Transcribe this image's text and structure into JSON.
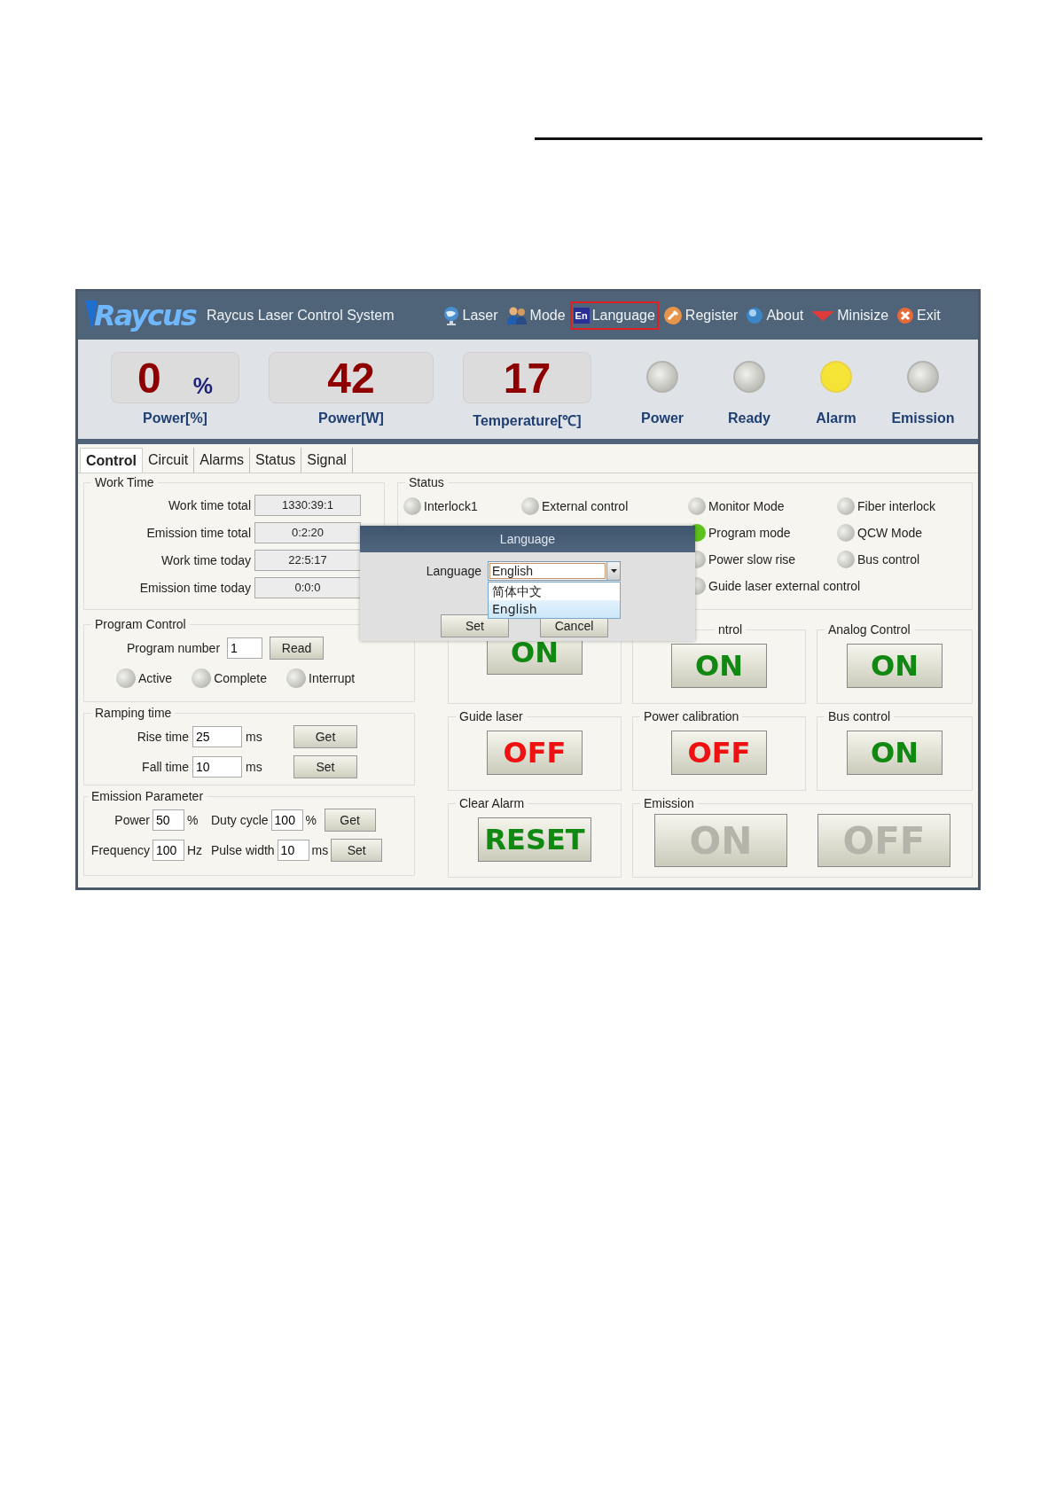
{
  "app": {
    "logo": "Raycus",
    "title": "Raycus Laser Control System"
  },
  "menu": [
    {
      "label": "Laser",
      "selected": false
    },
    {
      "label": "Mode",
      "selected": false
    },
    {
      "label": "Language",
      "badge": "En",
      "selected": true
    },
    {
      "label": "Register",
      "selected": false
    },
    {
      "label": "About",
      "selected": false
    },
    {
      "label": "Minisize",
      "selected": false
    },
    {
      "label": "Exit",
      "selected": false
    }
  ],
  "readouts": [
    {
      "value": "0",
      "unit": "%",
      "label": "Power[%]"
    },
    {
      "value": "42",
      "label": "Power[W]"
    },
    {
      "value": "17",
      "label": "Temperature[℃]"
    }
  ],
  "lamps": [
    {
      "label": "Power",
      "on": false
    },
    {
      "label": "Ready",
      "on": false
    },
    {
      "label": "Alarm",
      "on": true,
      "color": "#f5e336"
    },
    {
      "label": "Emission",
      "on": false
    }
  ],
  "tabs": [
    {
      "label": "Control",
      "selected": true
    },
    {
      "label": "Circuit",
      "selected": false
    },
    {
      "label": "Alarms",
      "selected": false
    },
    {
      "label": "Status",
      "selected": false
    },
    {
      "label": "Signal",
      "selected": false
    }
  ],
  "work_time": {
    "title": "Work Time",
    "rows": [
      {
        "label": "Work time total",
        "value": "1330:39:1"
      },
      {
        "label": "Emission time total",
        "value": "0:2:20"
      },
      {
        "label": "Work time today",
        "value": "22:5:17"
      },
      {
        "label": "Emission time today",
        "value": "0:0:0"
      }
    ]
  },
  "status": {
    "title": "Status",
    "columns": [
      [
        {
          "label": "Interlock1",
          "on": false
        }
      ],
      [
        {
          "label": "External control",
          "on": false
        }
      ],
      [
        {
          "label": "Monitor Mode",
          "on": false
        },
        {
          "label": "Program mode",
          "on": true,
          "color": "#5cc21c"
        },
        {
          "label": "Power slow rise",
          "on": false
        },
        {
          "label": "Guide laser external control",
          "on": false
        }
      ],
      [
        {
          "label": "Fiber interlock",
          "on": false
        },
        {
          "label": "QCW Mode",
          "on": false
        },
        {
          "label": "Bus control",
          "on": false
        }
      ]
    ]
  },
  "program_control": {
    "title": "Program Control",
    "number_label": "Program number",
    "number": "1",
    "button": "Read",
    "states": [
      {
        "label": "Active",
        "on": false
      },
      {
        "label": "Complete",
        "on": false
      },
      {
        "label": "Interrupt",
        "on": false
      }
    ]
  },
  "ramping": {
    "title": "Ramping time",
    "rows": [
      {
        "label": "Rise time",
        "value": "25",
        "unit": "ms",
        "button": "Get"
      },
      {
        "label": "Fall time",
        "value": "10",
        "unit": "ms",
        "button": "Set"
      }
    ]
  },
  "emission_parameter": {
    "title": "Emission Parameter",
    "rows": [
      {
        "fields": [
          {
            "label": "Power",
            "value": "50",
            "unit": "%"
          },
          {
            "label": "Duty cycle",
            "value": "100",
            "unit": "%"
          }
        ],
        "button": "Get"
      },
      {
        "fields": [
          {
            "label": "Frequency",
            "value": "100",
            "unit": "Hz"
          },
          {
            "label": "Pulse width",
            "value": "10",
            "unit": "ms"
          }
        ],
        "button": "Set"
      }
    ]
  },
  "switches": [
    {
      "button": "ON",
      "kind": "on"
    },
    {
      "title": "ntrol",
      "button": "ON",
      "kind": "on"
    },
    {
      "title": "Analog Control",
      "button": "ON",
      "kind": "on"
    },
    {
      "title": "Guide laser",
      "button": "OFF",
      "kind": "off"
    },
    {
      "title": "Power  calibration",
      "button": "OFF",
      "kind": "off"
    },
    {
      "title": "Bus control",
      "button": "ON",
      "kind": "on"
    },
    {
      "title": "Clear Alarm",
      "button": "RESET",
      "kind": "on"
    }
  ],
  "emission": {
    "title": "Emission",
    "buttons": [
      {
        "label": "ON",
        "disabled": true
      },
      {
        "label": "OFF",
        "disabled": true
      }
    ]
  },
  "dialog": {
    "title": "Language",
    "label": "Language",
    "value": "English",
    "options": [
      {
        "label": "简体中文",
        "selected": false
      },
      {
        "label": "English",
        "selected": true
      }
    ],
    "buttons": [
      "Set",
      "Cancel"
    ]
  }
}
